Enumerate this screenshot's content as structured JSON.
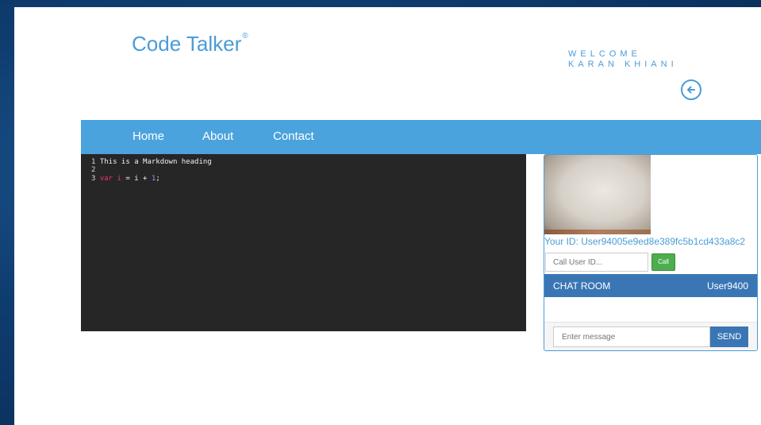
{
  "header": {
    "logo_text": "Code Talker",
    "logo_mark": "®",
    "welcome_line1": "WELCOME",
    "welcome_line2": "KARAN KHIANI",
    "back_icon": "arrow-left-circle-icon"
  },
  "nav": {
    "items": [
      {
        "label": "Home"
      },
      {
        "label": "About"
      },
      {
        "label": "Contact"
      }
    ]
  },
  "editor": {
    "lines": [
      {
        "num": "1",
        "text": "This is a Markdown heading"
      },
      {
        "num": "2",
        "text": ""
      },
      {
        "num": "3",
        "kw": "var",
        "var": "i",
        "mid": " = i + ",
        "num_lit": "1",
        "end": ";"
      }
    ]
  },
  "video": {
    "your_id": "Your ID: User94005e9ed8e389fc5b1cd433a8c2",
    "call_placeholder": "Call User ID...",
    "call_label": "Call"
  },
  "chat": {
    "title": "CHAT ROOM",
    "user": "User9400",
    "message_placeholder": "Enter message",
    "send_label": "SEND"
  },
  "colors": {
    "accent": "#4ba3dd",
    "chat_header": "#3a76b4",
    "call_green": "#4cae4c",
    "editor_bg": "#262626"
  }
}
